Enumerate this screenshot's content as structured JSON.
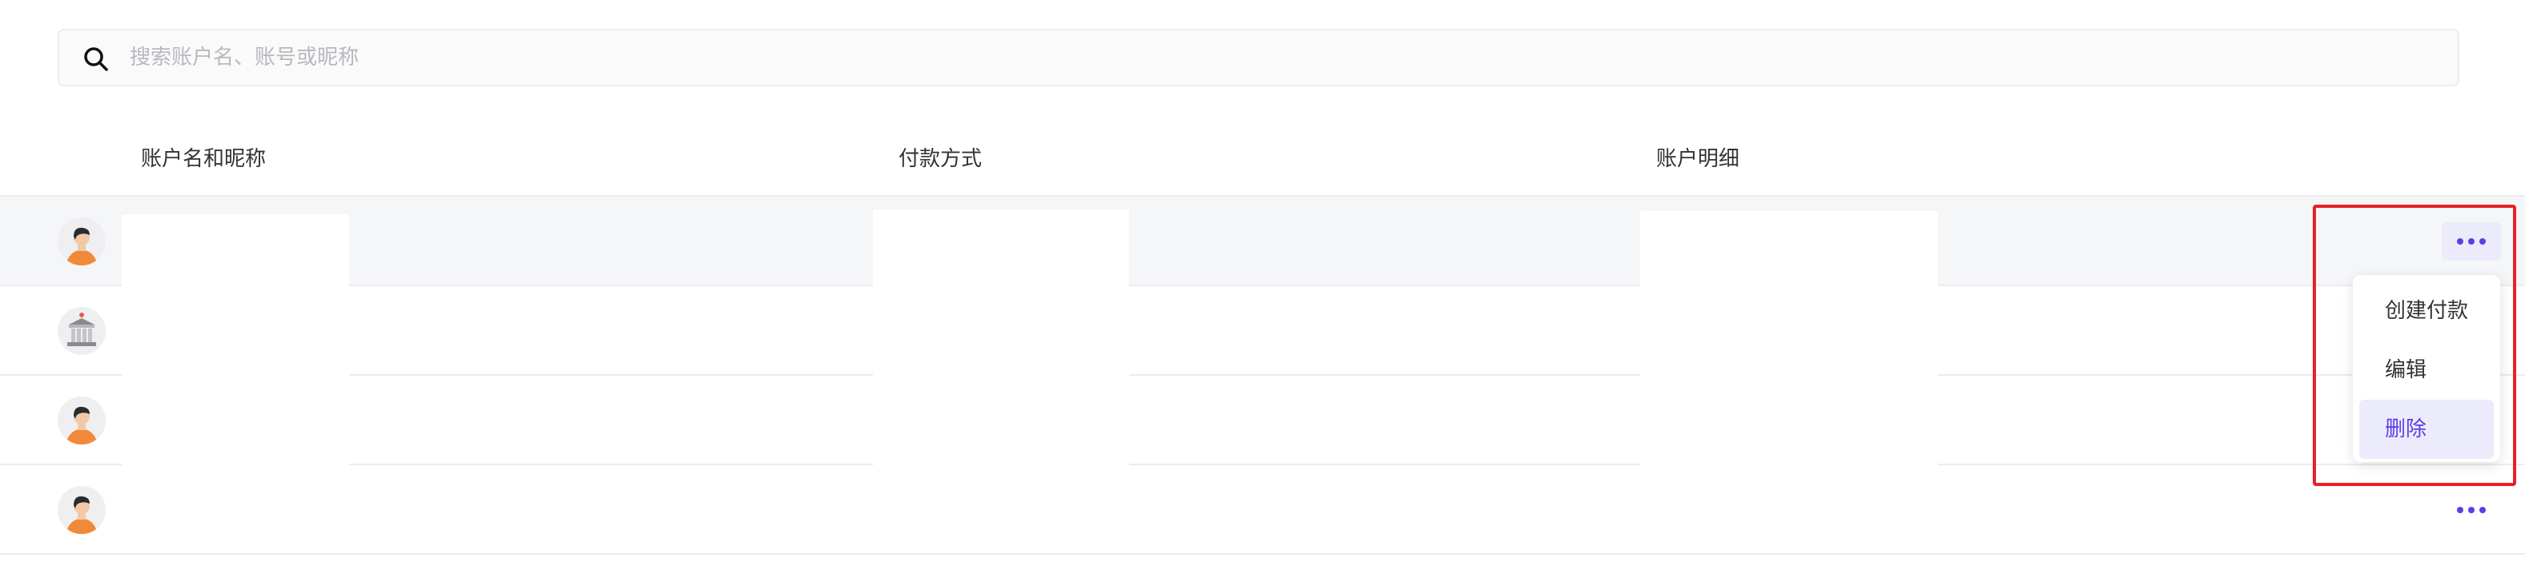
{
  "search": {
    "placeholder": "搜索账户名、账号或昵称",
    "value": "",
    "icon": "search-icon"
  },
  "table": {
    "headers": {
      "name": "账户名和昵称",
      "payment": "付款方式",
      "detail": "账户明细"
    },
    "rows": [
      {
        "avatar": "person-avatar-icon",
        "name": "",
        "payment": "",
        "detail": "",
        "menu_open": true
      },
      {
        "avatar": "bank-avatar-icon",
        "name": "",
        "payment": "",
        "detail": "",
        "menu_open": false
      },
      {
        "avatar": "person-avatar-icon",
        "name": "",
        "payment": "",
        "detail": "",
        "menu_open": false
      },
      {
        "avatar": "person-avatar-icon",
        "name": "",
        "payment": "",
        "detail": "",
        "menu_open": false
      }
    ]
  },
  "menu": {
    "items": [
      {
        "label": "创建付款"
      },
      {
        "label": "编辑"
      },
      {
        "label": "删除"
      }
    ]
  },
  "colors": {
    "accent": "#5b3ee6",
    "accent_bg": "#ecebfb",
    "highlight": "#e8202a",
    "row_hover": "#f5f6f8"
  }
}
